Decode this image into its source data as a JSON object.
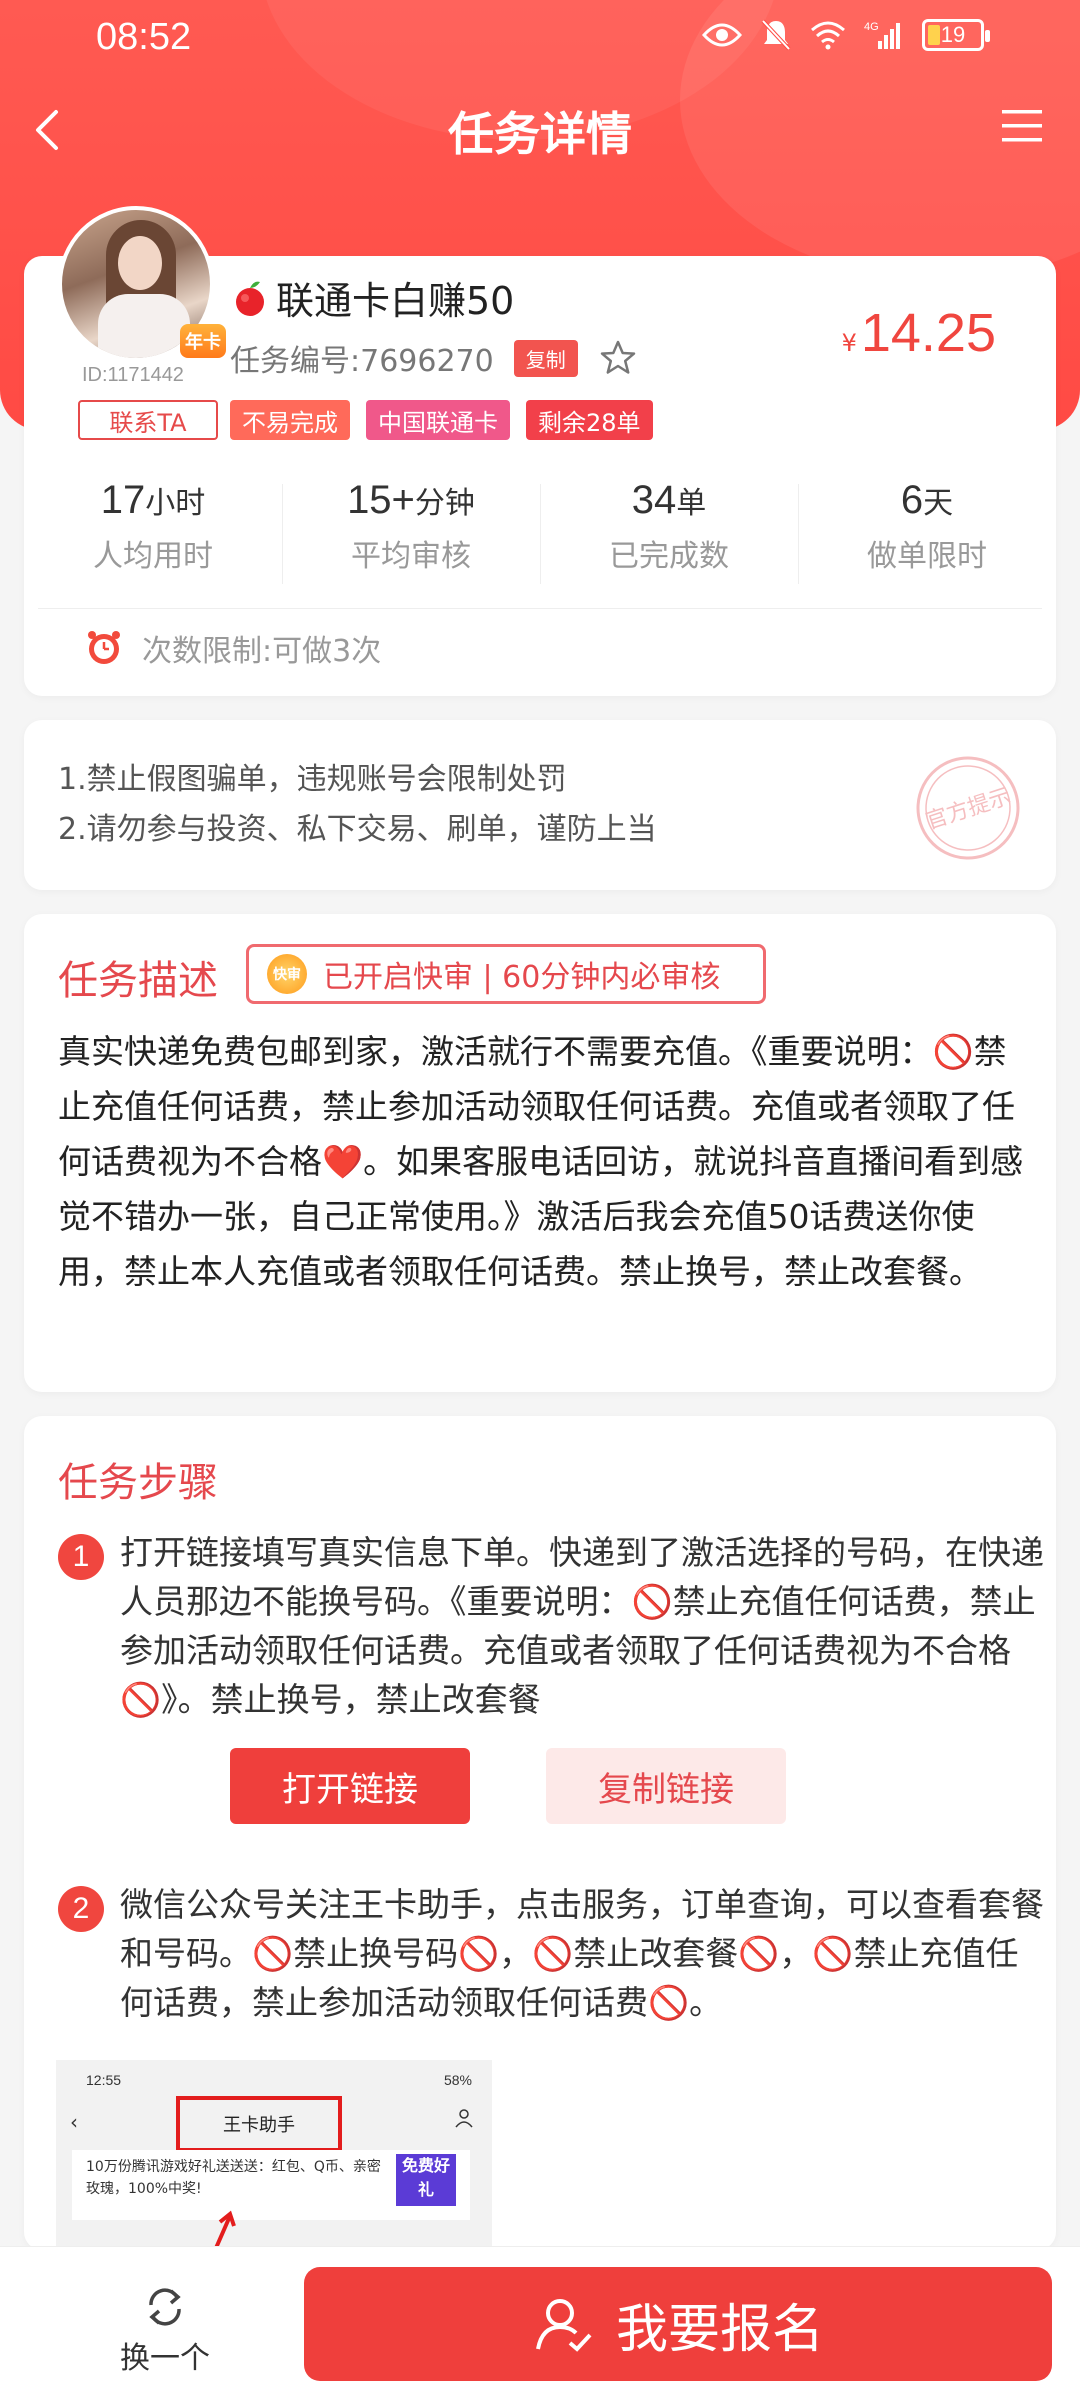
{
  "status_bar": {
    "time": "08:52",
    "battery": "19"
  },
  "header": {
    "title": "任务详情"
  },
  "task": {
    "badge": "年卡",
    "user_id": "ID:1171442",
    "contact": "联系TA",
    "name": "联通卡白赚50",
    "task_no": "任务编号:7696270",
    "copy": "复制",
    "price_currency": "¥",
    "price": "14.25",
    "tags": [
      "不易完成",
      "中国联通卡",
      "剩余28单"
    ],
    "stats": [
      {
        "num": "17",
        "unit": "小时",
        "label": "人均用时"
      },
      {
        "num": "15+",
        "unit": "分钟",
        "label": "平均审核"
      },
      {
        "num": "34",
        "unit": "单",
        "label": "已完成数"
      },
      {
        "num": "6",
        "unit": "天",
        "label": "做单限时"
      }
    ],
    "limit": "次数限制:可做3次"
  },
  "notice": {
    "lines": [
      "1.禁止假图骗单，违规账号会限制处罚",
      "2.请勿参与投资、私下交易、刷单，谨防上当"
    ],
    "stamp": "官方提示"
  },
  "description": {
    "title": "任务描述",
    "fast_icon": "快审",
    "fast_text": "已开启快审 | 60分钟内必审核",
    "text": "真实快递免费包邮到家，激活就行不需要充值。《重要说明：🚫禁止充值任何话费，禁止参加活动领取任何话费。充值或者领取了任何话费视为不合格❤️。如果客服电话回访，就说抖音直播间看到感觉不错办一张，自己正常使用。》激活后我会充值50话费送你使用，禁止本人充值或者领取任何话费。禁止换号，禁止改套餐。"
  },
  "steps": {
    "title": "任务步骤",
    "items": [
      {
        "num": "1",
        "text": "打开链接填写真实信息下单。快递到了激活选择的号码，在快递人员那边不能换号码。《重要说明：🚫禁止充值任何话费，禁止参加活动领取任何话费。充值或者领取了任何话费视为不合格🚫》。禁止换号，禁止改套餐"
      },
      {
        "num": "2",
        "text": "微信公众号关注王卡助手，点击服务，订单查询，可以查看套餐和号码。🚫禁止换号码🚫，🚫禁止改套餐🚫，🚫禁止充值任何话费，禁止参加活动领取任何话费🚫。"
      }
    ],
    "open_link": "打开链接",
    "copy_link": "复制链接",
    "screenshot": {
      "time": "12:55",
      "battery": "58%",
      "title": "王卡助手",
      "banner_text": "10万份腾讯游戏好礼送送送：红包、Q币、亲密玫瑰，100%中奖!",
      "free_gift": "免费好礼"
    }
  },
  "bottom": {
    "swap": "换一个",
    "signup": "我要报名"
  }
}
